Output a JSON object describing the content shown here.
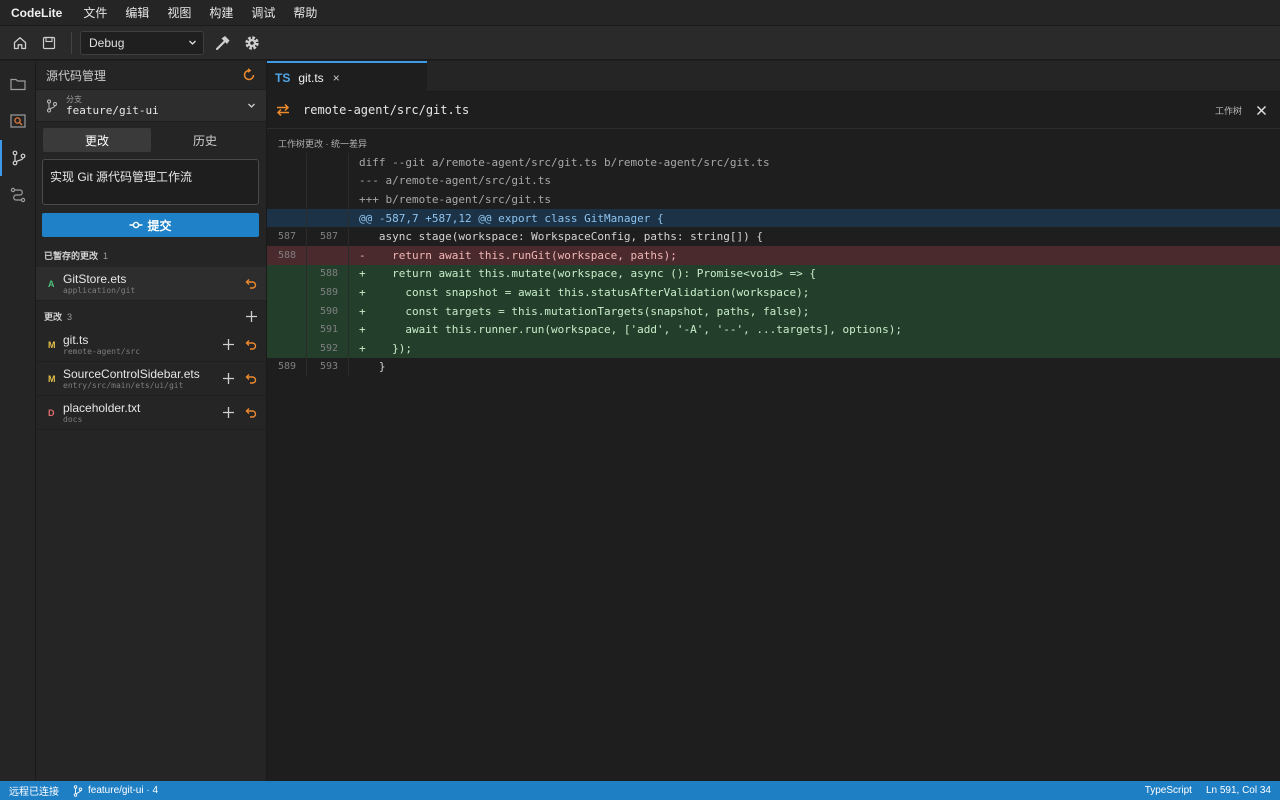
{
  "menubar": {
    "app_name": "CodeLite",
    "items": [
      "文件",
      "编辑",
      "视图",
      "构建",
      "调试",
      "帮助"
    ]
  },
  "toolbar": {
    "config_value": "Debug"
  },
  "sidebar": {
    "title": "源代码管理",
    "branch_caption": "分支",
    "branch_name": "feature/git-ui",
    "tabs": [
      "更改",
      "历史"
    ],
    "commit_message": "实现 Git 源代码管理工作流",
    "commit_button": "提交",
    "staged": {
      "label": "已暂存的更改",
      "count": "1",
      "files": [
        {
          "status": "A",
          "name": "GitStore.ets",
          "path": "application/git"
        }
      ]
    },
    "changes": {
      "label": "更改",
      "count": "3",
      "files": [
        {
          "status": "M",
          "name": "git.ts",
          "path": "remote-agent/src"
        },
        {
          "status": "M",
          "name": "SourceControlSidebar.ets",
          "path": "entry/src/main/ets/ui/git"
        },
        {
          "status": "D",
          "name": "placeholder.txt",
          "path": "docs"
        }
      ]
    }
  },
  "editor": {
    "tab_lang": "TS",
    "tab_name": "git.ts",
    "tab_close": "×",
    "diff_path": "remote-agent/src/git.ts",
    "worktree_label": "工作树",
    "subheader": "工作树更改 · 统一差异",
    "lines": [
      {
        "type": "meta",
        "old": "",
        "new": "",
        "text": "diff --git a/remote-agent/src/git.ts b/remote-agent/src/git.ts"
      },
      {
        "type": "meta",
        "old": "",
        "new": "",
        "text": "--- a/remote-agent/src/git.ts"
      },
      {
        "type": "meta",
        "old": "",
        "new": "",
        "text": "+++ b/remote-agent/src/git.ts"
      },
      {
        "type": "hunk",
        "old": "",
        "new": "",
        "text": "@@ -587,7 +587,12 @@ export class GitManager {"
      },
      {
        "type": "ctx",
        "old": "587",
        "new": "587",
        "text": "   async stage(workspace: WorkspaceConfig, paths: string[]) {"
      },
      {
        "type": "del",
        "old": "588",
        "new": "",
        "text": "-    return await this.runGit(workspace, paths);"
      },
      {
        "type": "add",
        "old": "",
        "new": "588",
        "text": "+    return await this.mutate(workspace, async (): Promise<void> => {"
      },
      {
        "type": "add",
        "old": "",
        "new": "589",
        "text": "+      const snapshot = await this.statusAfterValidation(workspace);"
      },
      {
        "type": "add",
        "old": "",
        "new": "590",
        "text": "+      const targets = this.mutationTargets(snapshot, paths, false);"
      },
      {
        "type": "add",
        "old": "",
        "new": "591",
        "text": "+      await this.runner.run(workspace, ['add', '-A', '--', ...targets], options);"
      },
      {
        "type": "add",
        "old": "",
        "new": "592",
        "text": "+    });"
      },
      {
        "type": "ctx",
        "old": "589",
        "new": "593",
        "text": "   }"
      }
    ]
  },
  "statusbar": {
    "connection": "远程已连接",
    "branch": "feature/git-ui · 4",
    "language": "TypeScript",
    "cursor": "Ln 591, Col 34"
  },
  "colors": {
    "accent": "#1f7fc4",
    "added": "#4ec07a",
    "modified": "#e2c04a",
    "deleted": "#e06c6c",
    "discard": "#ee8a2c"
  }
}
